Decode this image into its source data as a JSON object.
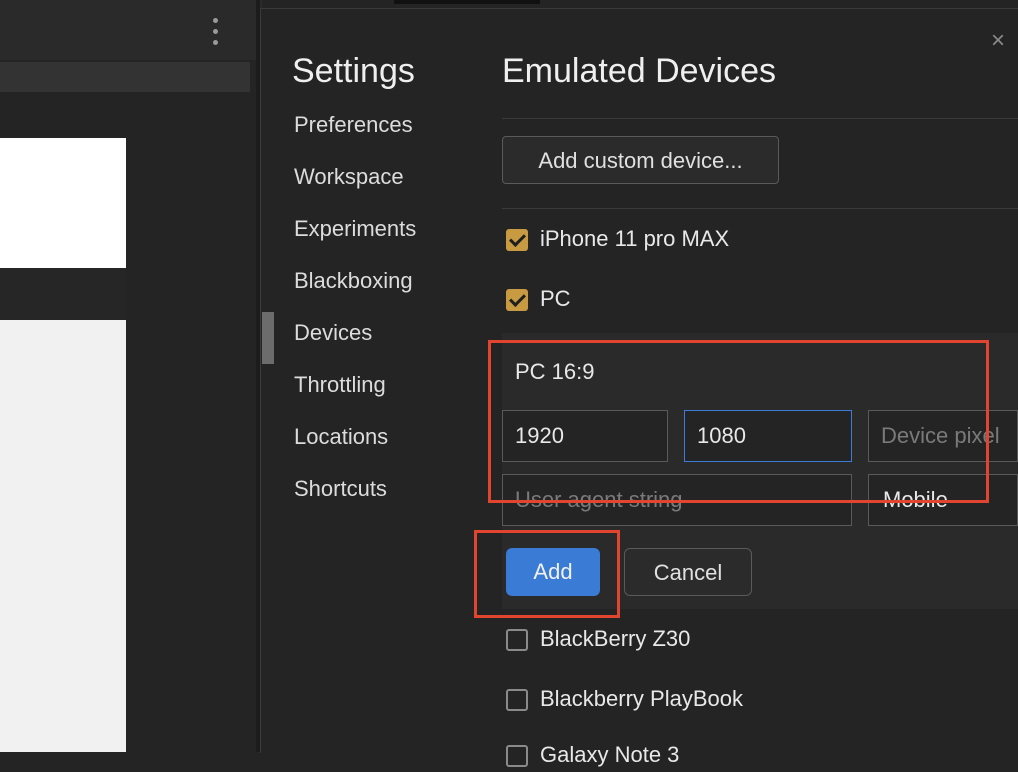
{
  "settings": {
    "title": "Settings",
    "nav": [
      {
        "label": "Preferences"
      },
      {
        "label": "Workspace"
      },
      {
        "label": "Experiments"
      },
      {
        "label": "Blackboxing"
      },
      {
        "label": "Devices"
      },
      {
        "label": "Throttling"
      },
      {
        "label": "Locations"
      },
      {
        "label": "Shortcuts"
      }
    ],
    "selected_nav": "Devices",
    "close_label": "×"
  },
  "panel": {
    "title": "Emulated Devices",
    "add_custom_label": "Add custom device...",
    "devices_before": [
      {
        "name": "iPhone 11 pro MAX",
        "checked": true
      },
      {
        "name": "PC",
        "checked": true
      }
    ],
    "devices_after": [
      {
        "name": "BlackBerry Z30",
        "checked": false
      },
      {
        "name": "Blackberry PlayBook",
        "checked": false
      },
      {
        "name": "Galaxy Note 3",
        "checked": false
      }
    ]
  },
  "edit_form": {
    "name_value": "PC 16:9",
    "width_value": "1920",
    "height_value": "1080",
    "dpr_placeholder": "Device pixel ratio",
    "ua_placeholder": "User agent string",
    "type_value": "Mobile",
    "add_label": "Add",
    "cancel_label": "Cancel"
  },
  "colors": {
    "accent_blue": "#3a7bd5",
    "checkbox_checked": "#c89a42",
    "annotation_red": "#e2452f"
  }
}
